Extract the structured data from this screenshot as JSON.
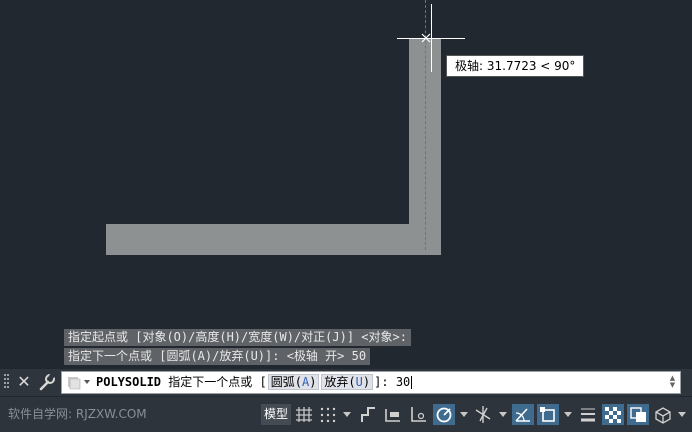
{
  "drawing": {
    "tooltip": "极轴: 31.7723 < 90°"
  },
  "history": {
    "line1": "指定起点或 [对象(O)/高度(H)/宽度(W)/对正(J)] <对象>:",
    "line2": "指定下一个点或 [圆弧(A)/放弃(U)]:  <极轴 开> 50"
  },
  "command": {
    "name": "POLYSOLID",
    "prompt": " 指定下一个点或 [",
    "option1_text": "圆弧(",
    "option1_key": "A",
    "option1_end": ")",
    "option2_text": "放弃(",
    "option2_key": "U",
    "option2_end": ")",
    "suffix": "]: ",
    "input_value": "30"
  },
  "statusbar": {
    "watermark": "软件自学网: RJZXW.COM",
    "model_label": "模型",
    "icons": [
      "grid-icon",
      "snap-icon",
      "ortho-icon",
      "infer-icon",
      "polar-icon",
      "isodraft-icon",
      "osnap-track-icon",
      "osnap-icon",
      "lineweight-icon",
      "transparency-icon",
      "selection-cycling-icon",
      "3d-osnap-icon"
    ]
  },
  "colors": {
    "background": "#212830",
    "solid": "#8e9192",
    "polar_guide": "#1ea83a",
    "crosshair": "#ffffff",
    "active_status": "#3f6b8f"
  }
}
